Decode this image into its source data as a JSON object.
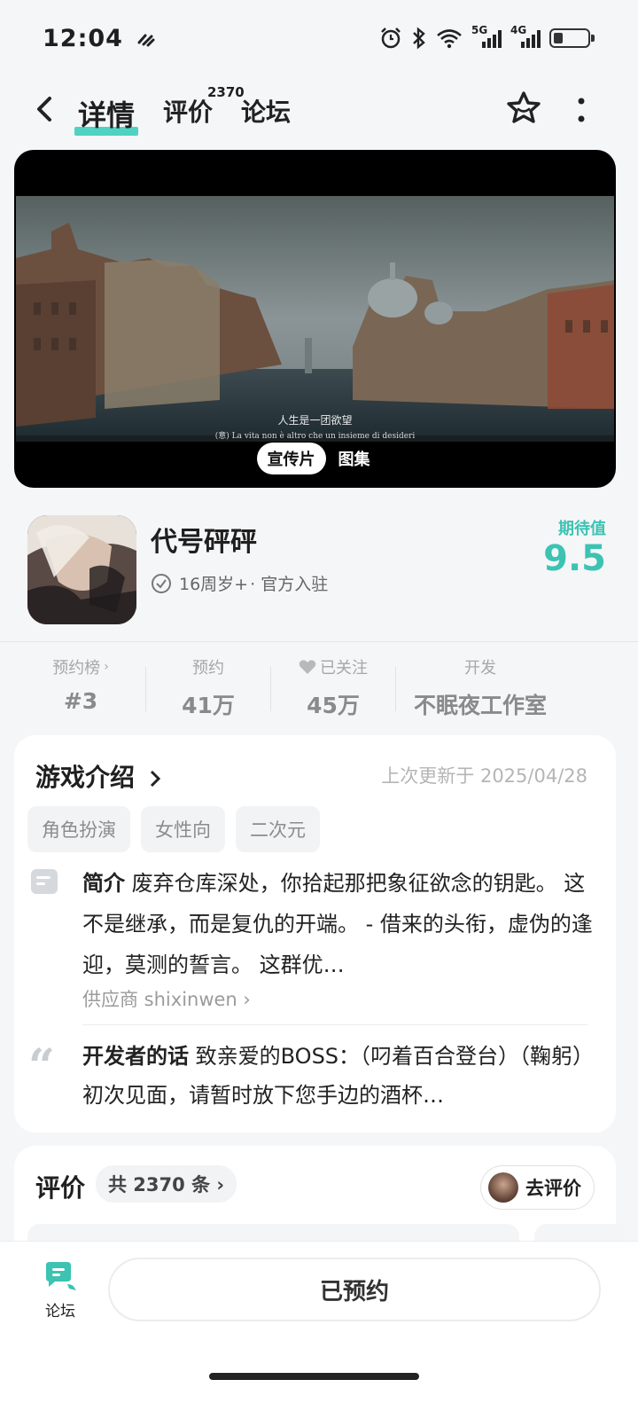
{
  "status_bar": {
    "time": "12:04",
    "net1": "5G",
    "net2": "4G"
  },
  "nav": {
    "tabs": [
      {
        "label": "详情"
      },
      {
        "label": "评价"
      },
      {
        "label": "论坛"
      }
    ],
    "review_badge": "2370"
  },
  "hero": {
    "caption_line1": "人生是一团欲望",
    "caption_line2": "(意) La vita non è altro che un insieme di desideri",
    "media_tabs": [
      "宣传片",
      "图集"
    ]
  },
  "game": {
    "title": "代号砰砰",
    "age": "16周岁+",
    "badge": "· 官方入驻",
    "expect_label": "期待值",
    "expect_value": "9.5",
    "accent_color": "#3cc3b2"
  },
  "stats": [
    {
      "label": "预约榜",
      "value": "#3"
    },
    {
      "label": "预约",
      "value": "41万"
    },
    {
      "label": "已关注",
      "value": "45万"
    },
    {
      "label": "开发",
      "value": "不眠夜工作室"
    }
  ],
  "intro": {
    "title": "游戏介绍",
    "updated": "上次更新于 2025/04/28",
    "tags": [
      "角色扮演",
      "女性向",
      "二次元"
    ],
    "summary_label": "简介",
    "summary_text": "废弃仓库深处，你拾起那把象征欲念的钥匙。 这不是继承，而是复仇的开端。 - 借来的头衔，虚伪的逢迎，莫测的誓言。 这群优…",
    "supplier": "供应商 shixinwen",
    "dev_label": "开发者的话",
    "dev_text": "致亲爱的BOSS：（叼着百合登台）（鞠躬）初次见面，请暂时放下您手边的酒杯…"
  },
  "reviews": {
    "title": "评价",
    "count": "共 2370 条",
    "go_review": "去评价"
  },
  "bottom": {
    "forum_label": "论坛",
    "reserved_label": "已预约"
  }
}
